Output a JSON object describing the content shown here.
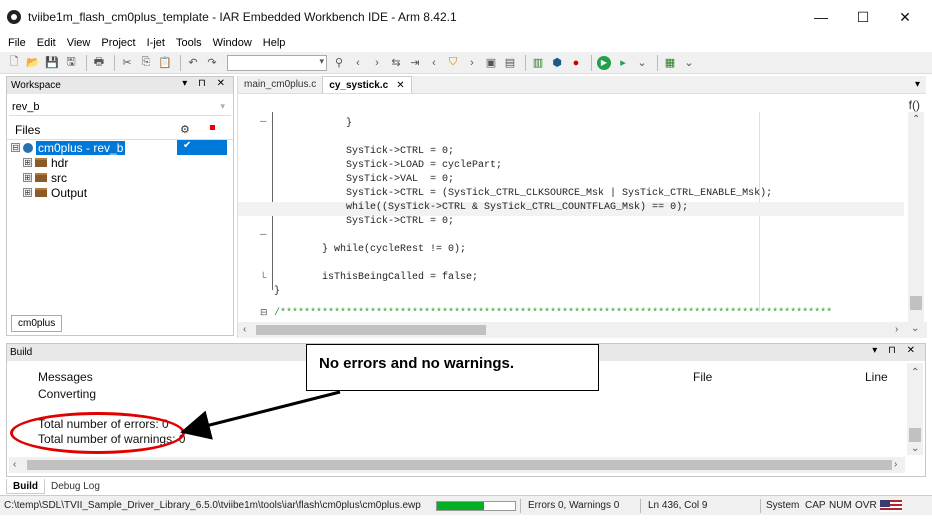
{
  "window": {
    "title": "tviibe1m_flash_cm0plus_template - IAR Embedded Workbench IDE - Arm 8.42.1",
    "minimize": "—",
    "maximize": "☐",
    "close": "✕"
  },
  "menu": [
    "File",
    "Edit",
    "View",
    "Project",
    "I-jet",
    "Tools",
    "Window",
    "Help"
  ],
  "workspace": {
    "header": "Workspace",
    "ctrls": "▾ ⊓ ✕",
    "config": "rev_b",
    "files_label": "Files",
    "tree": [
      {
        "label": "cm0plus - rev_b",
        "expander": "⊟",
        "check": "✔"
      },
      {
        "label": "hdr",
        "expander": "⊞"
      },
      {
        "label": "src",
        "expander": "⊞"
      },
      {
        "label": "Output",
        "expander": "⊞"
      }
    ],
    "tab": "cm0plus"
  },
  "editor": {
    "tabs": [
      {
        "label": "main_cm0plus.c",
        "active": false
      },
      {
        "label": "cy_systick.c",
        "active": true,
        "close": "✕"
      }
    ],
    "func_icon": "f()",
    "code": [
      "            }",
      "",
      "            SysTick->CTRL = 0;",
      "            SysTick->LOAD = cyclePart;",
      "            SysTick->VAL  = 0;",
      "            SysTick->CTRL = (SysTick_CTRL_CLKSOURCE_Msk | SysTick_CTRL_ENABLE_Msk);",
      "            while((SysTick->CTRL & SysTick_CTRL_COUNTFLAG_Msk) == 0);",
      "            SysTick->CTRL = 0;",
      "",
      "        } while(cycleRest != 0);",
      "",
      "        isThisBeingCalled = false;",
      "    }",
      "",
      "    /********************************************************************************************"
    ]
  },
  "build": {
    "header": "Build",
    "ctrls": "▾ ⊓ ✕",
    "col_messages": "Messages",
    "col_file": "File",
    "col_line": "Line",
    "lines": [
      "Converting",
      "",
      "Total number of errors: 0",
      "Total number of warnings: 0"
    ],
    "tabs": [
      {
        "label": "Build",
        "active": true
      },
      {
        "label": "Debug Log",
        "active": false
      }
    ]
  },
  "callout": "No errors and no warnings.",
  "status": {
    "path": "C:\\temp\\SDL\\TVII_Sample_Driver_Library_6.5.0\\tviibe1m\\tools\\iar\\flash\\cm0plus\\cm0plus.ewp",
    "progress": 0.6,
    "errors": "Errors 0, Warnings 0",
    "position": "Ln 436, Col 9",
    "mode": "System",
    "cap": "CAP",
    "num": "NUM",
    "ovr": "OVR"
  },
  "colors": {
    "accent": "#0078d7",
    "highlight": "#e00000",
    "progress": "#06b025"
  }
}
